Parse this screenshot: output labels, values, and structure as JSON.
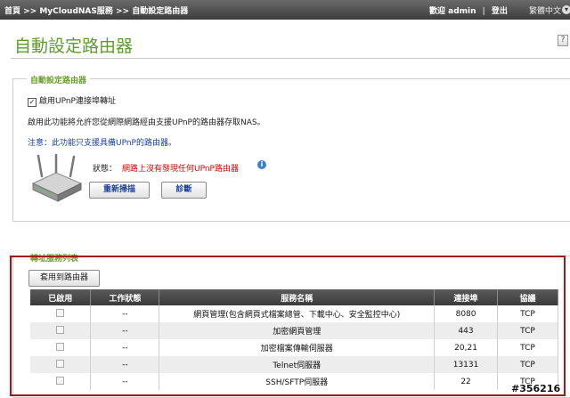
{
  "header": {
    "breadcrumb": "首頁 >> MyCloudNAS服務 >> 自動設定路由器",
    "welcome": "歡迎 admin",
    "logout": "登出",
    "language": "繁體中文"
  },
  "page": {
    "title": "自動設定路由器"
  },
  "upnp_section": {
    "legend": "自動設定路由器",
    "checkbox_label": "啟用UPnP連接埠轉址",
    "checkbox_checked": true,
    "description": "啟用此功能將允許您從網際網路經由支援UPnP的路由器存取NAS。",
    "note": "注意：此功能只支援具備UPnP的路由器。",
    "status_label": "狀態：",
    "status_text": "網路上沒有發現任何UPnP路由器",
    "rescan_button": "重新掃描",
    "diagnose_button": "診斷"
  },
  "forwarding_section": {
    "legend": "轉址服務列表",
    "apply_button": "套用到路由器",
    "columns": [
      "已啟用",
      "工作狀態",
      "服務名稱",
      "連接埠",
      "協議"
    ],
    "rows": [
      {
        "status": "--",
        "service": "網頁管理(包含網頁式檔案總管、下載中心、安全監控中心)",
        "port": "8080",
        "protocol": "TCP"
      },
      {
        "status": "--",
        "service": "加密網頁管理",
        "port": "443",
        "protocol": "TCP"
      },
      {
        "status": "--",
        "service": "加密檔案傳輸伺服器",
        "port": "20,21",
        "protocol": "TCP"
      },
      {
        "status": "--",
        "service": "Telnet伺服器",
        "port": "13131",
        "protocol": "TCP"
      },
      {
        "status": "--",
        "service": "SSH/SFTP伺服器",
        "port": "22",
        "protocol": "TCP"
      }
    ]
  },
  "watermark": "#356216"
}
